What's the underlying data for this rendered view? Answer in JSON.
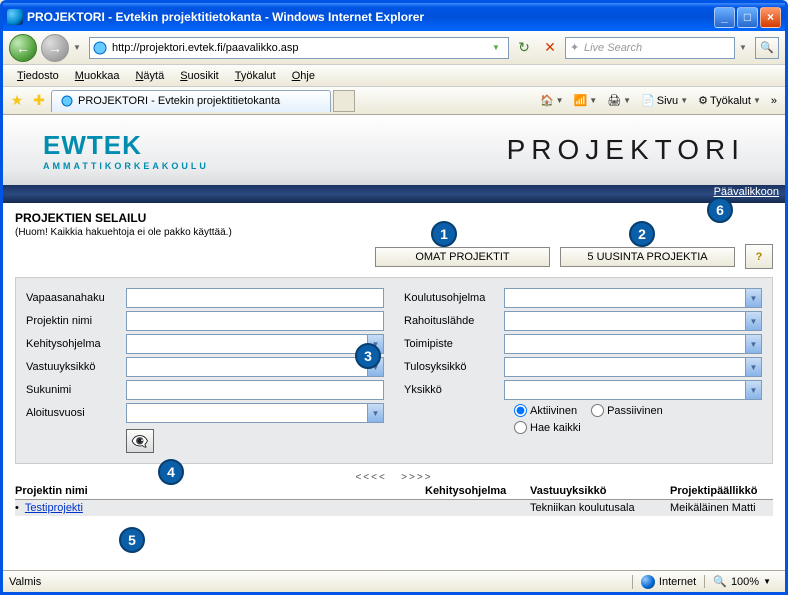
{
  "window_title": "PROJEKTORI - Evtekin projektitietokanta - Windows Internet Explorer",
  "url": "http://projektori.evtek.fi/paavalikko.asp",
  "search_placeholder": "Live Search",
  "menu": {
    "file": "Tiedosto",
    "edit": "Muokkaa",
    "view": "Näytä",
    "fav": "Suosikit",
    "tools": "Työkalut",
    "help": "Ohje"
  },
  "tab": {
    "title": "PROJEKTORI - Evtekin projektitietokanta"
  },
  "toolbar": {
    "page": "Sivu",
    "tools": "Työkalut"
  },
  "logo": {
    "text": "EWTEK",
    "sub": "AMMATTIKORKEAKOULU",
    "right": "PROJEKTORI"
  },
  "navy_link": "Päävalikkoon",
  "section": {
    "title": "PROJEKTIEN SELAILU",
    "note": "(Huom! Kaikkia hakuehtoja ei ole pakko käyttää.)",
    "btn_own": "OMAT PROJEKTIT",
    "btn_latest": "5 UUSINTA PROJEKTIA",
    "help": "?"
  },
  "labels": {
    "vapaasana": "Vapaasanahaku",
    "projnimi": "Projektin nimi",
    "kehitys": "Kehitysohjelma",
    "vastuu": "Vastuuyksikkö",
    "sukunimi": "Sukunimi",
    "aloitus": "Aloitusvuosi",
    "koulutus": "Koulutusohjelma",
    "rahoitus": "Rahoituslähde",
    "toimi": "Toimipiste",
    "tulos": "Tulosyksikkö",
    "yksikko": "Yksikkö"
  },
  "radios": {
    "aktiivinen": "Aktiivinen",
    "passiivinen": "Passiivinen",
    "hae": "Hae kaikki"
  },
  "pager": {
    "prev": "<<<<",
    "next": ">>>>"
  },
  "table": {
    "h1": "Projektin nimi",
    "h2": "Kehitysohjelma",
    "h3": "Vastuuyksikkö",
    "h4": "Projektipäällikkö",
    "rows": [
      {
        "name": "Testiprojekti",
        "keh": "",
        "vastuu": "Tekniikan koulutusala",
        "pm": "Meikäläinen Matti"
      }
    ]
  },
  "status": {
    "left": "Valmis",
    "zone": "Internet",
    "zoom": "100%"
  },
  "anno": {
    "a1": "1",
    "a2": "2",
    "a3": "3",
    "a4": "4",
    "a5": "5",
    "a6": "6"
  }
}
